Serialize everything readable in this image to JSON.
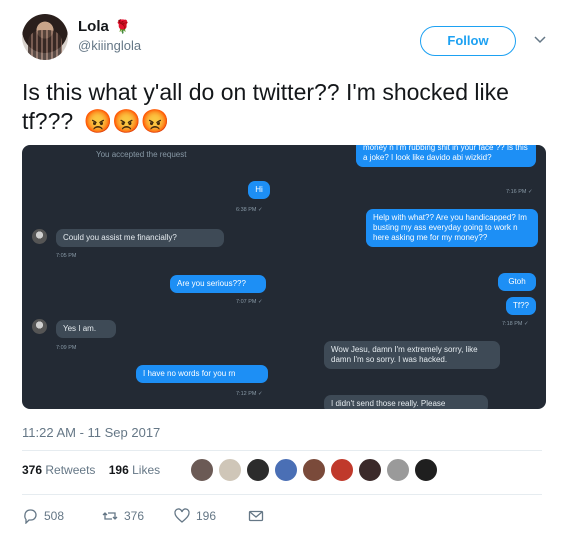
{
  "user": {
    "name": "Lola",
    "name_emoji": "🌹",
    "handle": "@kiiinglola"
  },
  "follow_label": "Follow",
  "tweet": {
    "text": "Is this what y'all do on twitter?? I'm shocked like tf???",
    "emoji": "😡😡😡"
  },
  "screenshot": {
    "accepted": "You accepted the request",
    "left_col": {
      "hi": "Hi",
      "hi_meta": "6:38 PM ✓",
      "assist": "Could you assist me financially?",
      "assist_meta": "7:05 PM",
      "serious": "Are you serious???",
      "serious_meta": "7:07 PM ✓",
      "yes": "Yes I am.",
      "yes_meta": "7:09 PM",
      "nowords": "I have no words for you rn",
      "nowords_meta": "7:12 PM ✓"
    },
    "right_col": {
      "top": "money n I'm rubbing shit in your face ?? Is this a joke? I look like davido abi wizkid?",
      "top_meta": "7:16 PM ✓",
      "help": "Help with what?? Are you handicapped? Im busting my ass everyday going to work n here asking me for my money??",
      "gtoh": "Gtoh",
      "tf": "Tf??",
      "tf_meta": "7:18 PM ✓",
      "wow": "Wow Jesu, damn I'm extremely sorry, like damn I'm so sorry. I was hacked.",
      "didnt": "I didn't send those really. Please"
    }
  },
  "timestamp": "11:22 AM - 11 Sep 2017",
  "stats": {
    "retweets_count": "376",
    "retweets_label": "Retweets",
    "likes_count": "196",
    "likes_label": "Likes"
  },
  "actions": {
    "replies": "508",
    "retweets": "376",
    "likes": "196"
  },
  "colors": {
    "accent": "#1da1f2",
    "dm_blue": "#1d8ff5",
    "dm_bg": "#232a34",
    "muted": "#657786"
  }
}
